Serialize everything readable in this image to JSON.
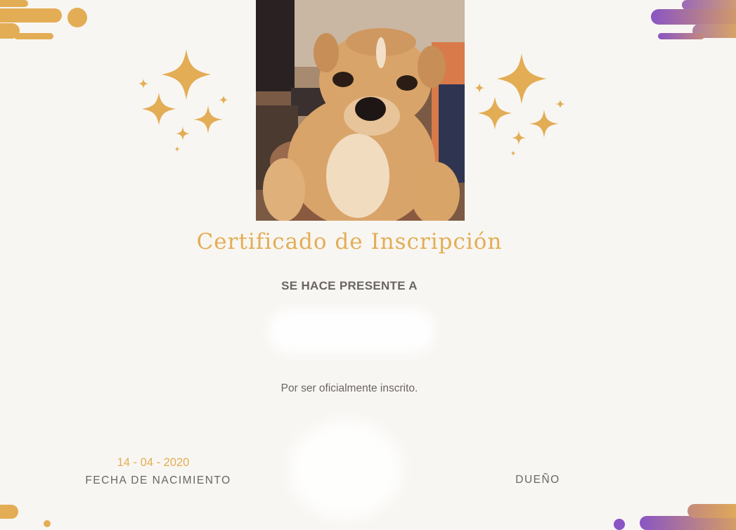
{
  "certificate": {
    "title": "Certificado de Inscripción",
    "presented_to": "SE HACE PRESENTE A",
    "reason": "Por ser oficialmente inscrito.",
    "birth_date": "14 - 04 - 2020",
    "birth_label": "FECHA DE NACIMIENTO",
    "owner_label": "DUEÑO"
  },
  "photo": {
    "subject": "chihuahua-dog-photo"
  },
  "colors": {
    "accent": "#e3ad55",
    "text": "#6a6566",
    "background": "#f8f6f2",
    "purple": "#8a55c4"
  }
}
